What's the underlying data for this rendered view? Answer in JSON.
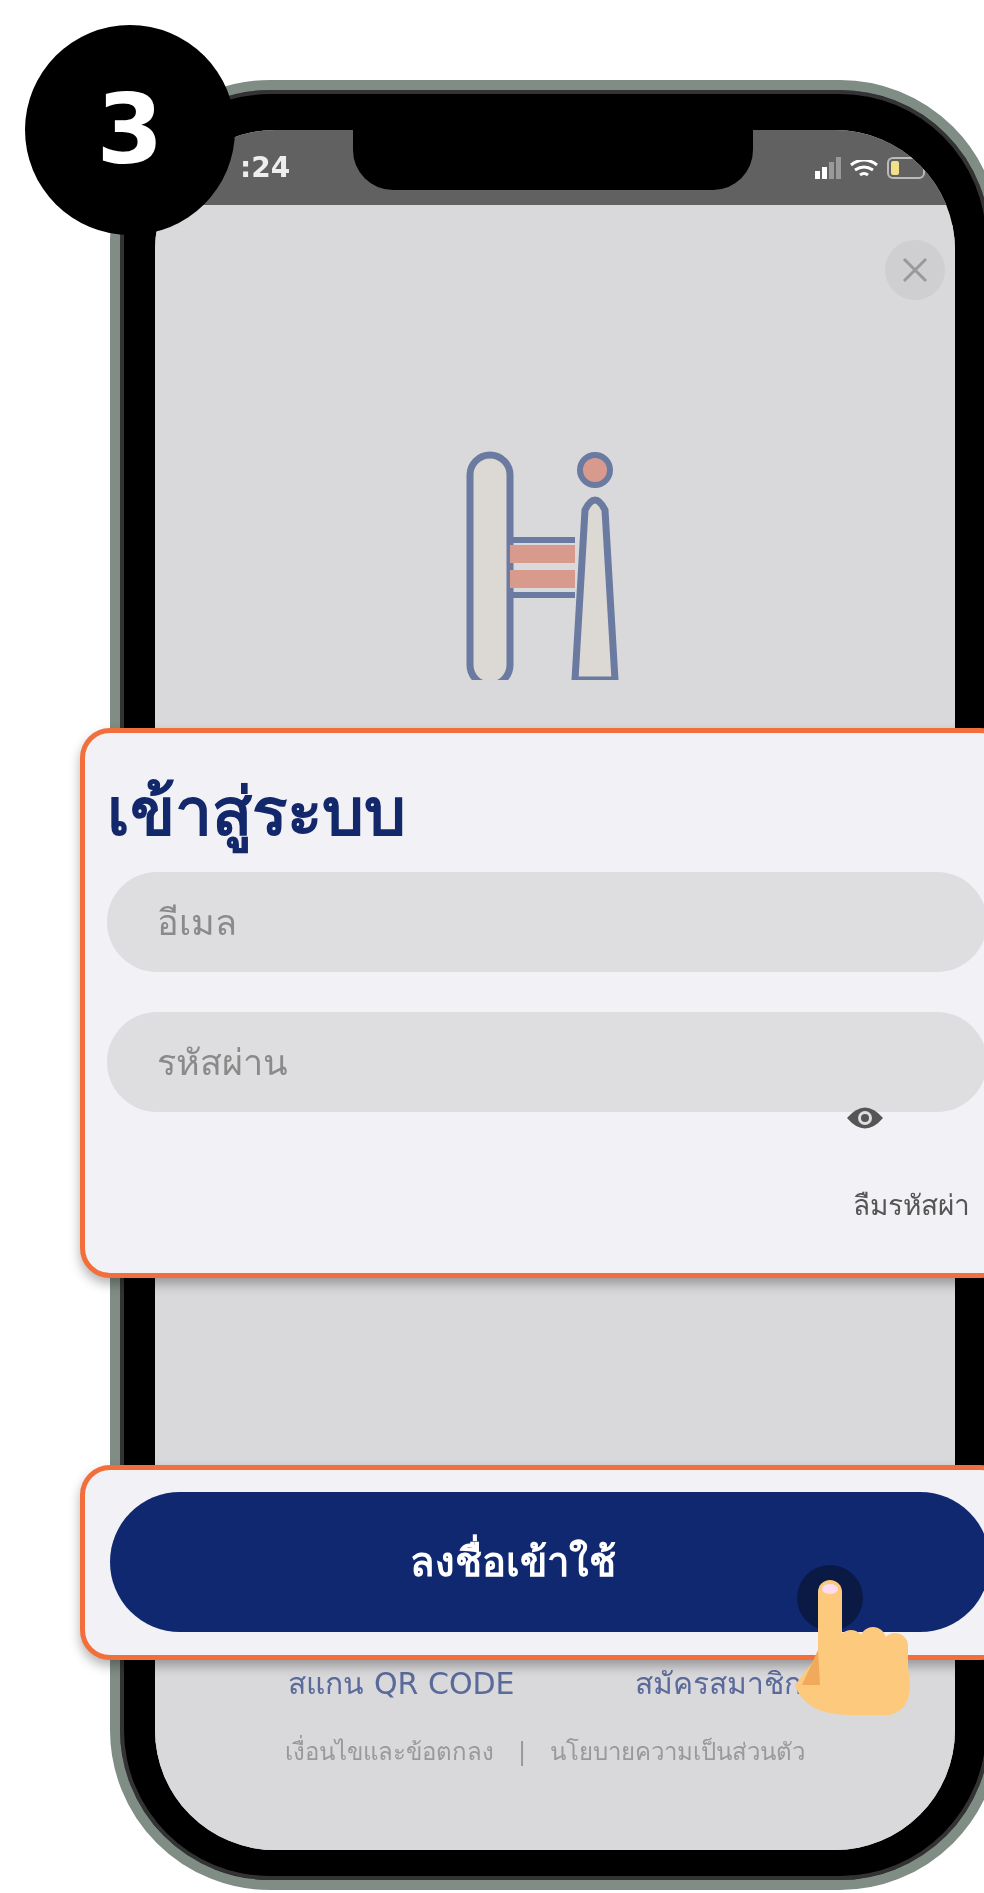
{
  "step": {
    "number": "3"
  },
  "status_bar": {
    "time": ":24"
  },
  "login": {
    "title": "เข้าสู่ระบบ",
    "email": {
      "placeholder": "อีเมล"
    },
    "password": {
      "placeholder": "รหัสผ่าน"
    },
    "forgot_link": "ลืมรหัสผ่า",
    "submit_button": "ลงชื่อเข้าใช้"
  },
  "links": [
    "สแกน QR CODE",
    "สมัครสมาชิก"
  ],
  "footer": {
    "terms": "เงื่อนไขและข้อตกลง",
    "separator": "|",
    "privacy": "นโยบายความเป็นส่วนตัว"
  }
}
